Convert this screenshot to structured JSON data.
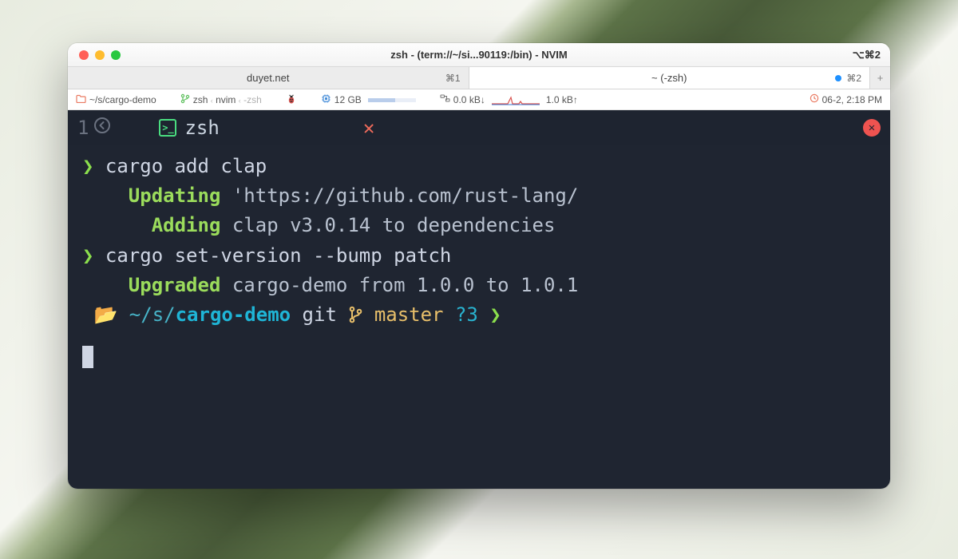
{
  "titlebar": {
    "title": "zsh - (term://~/si...90119:/bin) - NVIM",
    "right": "⌥⌘2"
  },
  "tabs": {
    "left_label": "duyet.net",
    "left_shortcut": "⌘1",
    "right_label": "~ (-zsh)",
    "right_shortcut": "⌘2"
  },
  "status": {
    "path": "~/s/cargo-demo",
    "process": "zsh ‹ nvim ‹ -zsh",
    "mem": "12 GB",
    "net_down": "0.0 kB↓",
    "net_up": "1.0 kB↑",
    "time": "06-2, 2:18 PM"
  },
  "nvimtab": {
    "index": "1",
    "name": "zsh"
  },
  "terminal": {
    "cmd1": "cargo add clap",
    "l2_kw": "Updating",
    "l2_rest": " 'https://github.com/rust-lang/",
    "l3_kw": "Adding",
    "l3_rest": " clap v3.0.14 to dependencies",
    "cmd2": "cargo set-version --bump patch",
    "l5_kw": "Upgraded",
    "l5_rest": " cargo-demo from 1.0.0 to 1.0.1",
    "prompt_path_dim": "~/s/",
    "prompt_path_bold": "cargo-demo",
    "git_label": "git",
    "git_branch": "master",
    "git_unknown": "?3"
  }
}
